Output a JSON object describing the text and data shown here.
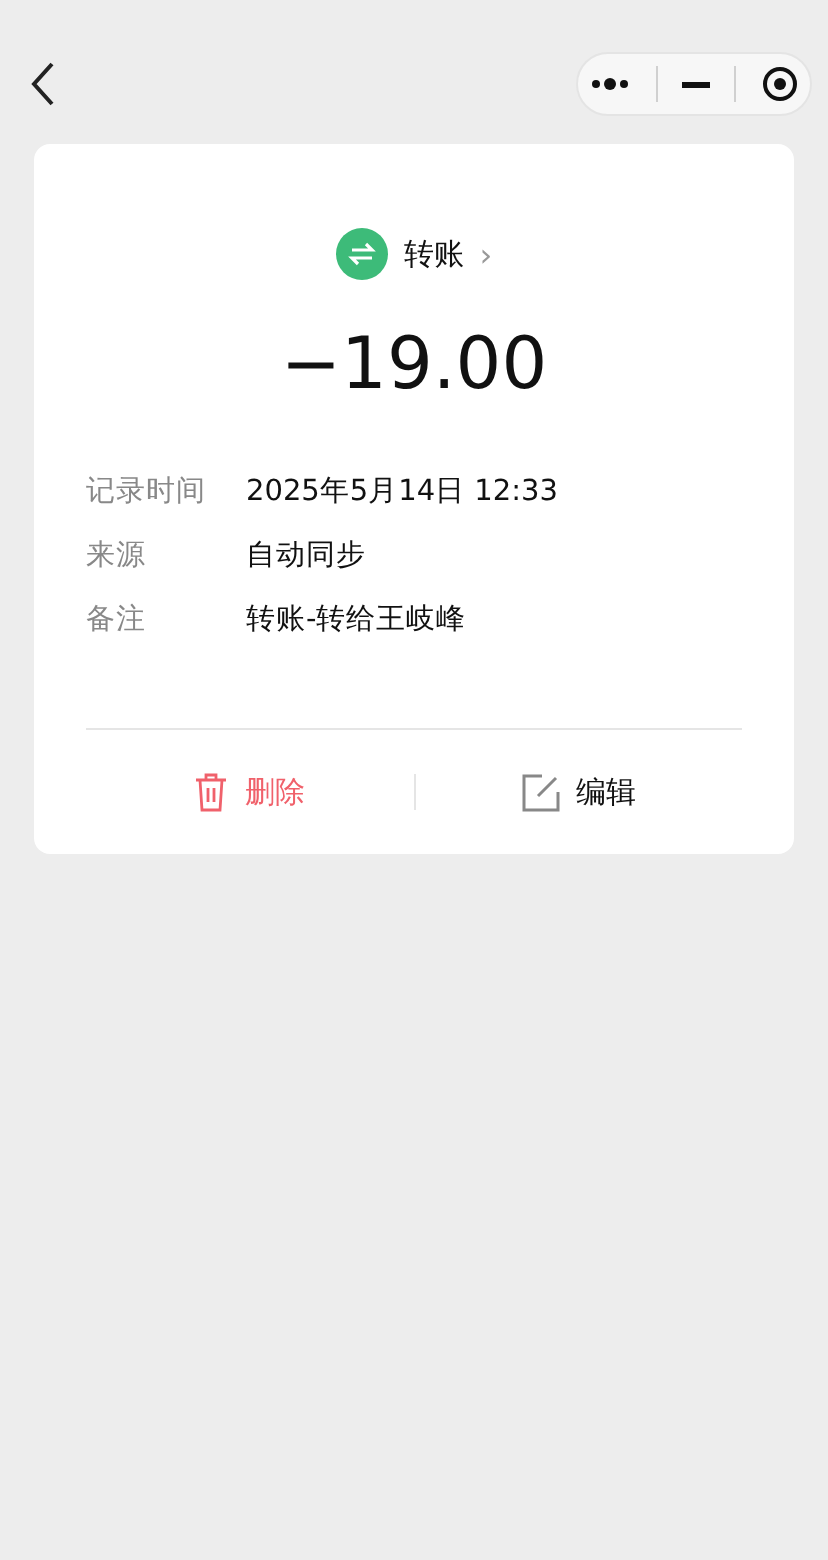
{
  "category": {
    "label": "转账",
    "chevron": "›"
  },
  "amount": "−19.00",
  "details": [
    {
      "label": "记录时间",
      "value": "2025年5月14日 12:33"
    },
    {
      "label": "来源",
      "value": "自动同步"
    },
    {
      "label": "备注",
      "value": "转账-转给王岐峰"
    }
  ],
  "actions": [
    {
      "kind": "delete",
      "label": "删除"
    },
    {
      "kind": "edit",
      "label": "编辑"
    }
  ]
}
